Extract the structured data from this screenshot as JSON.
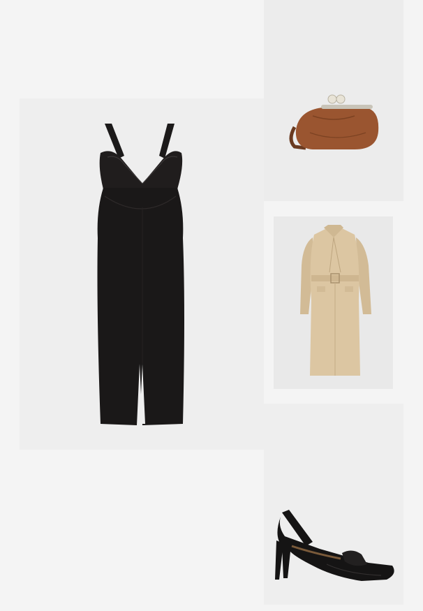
{
  "collage": {
    "background": "#f4f4f4",
    "items": [
      {
        "id": "dress",
        "kind": "black midi dress",
        "color": "#1c1a1a"
      },
      {
        "id": "bag",
        "kind": "brown leather pouch bag",
        "color": "#9a5530"
      },
      {
        "id": "coat",
        "kind": "beige trench coat",
        "color": "#d8c3a1"
      },
      {
        "id": "shoes",
        "kind": "black slingback loafer pumps",
        "color": "#151414"
      }
    ]
  }
}
